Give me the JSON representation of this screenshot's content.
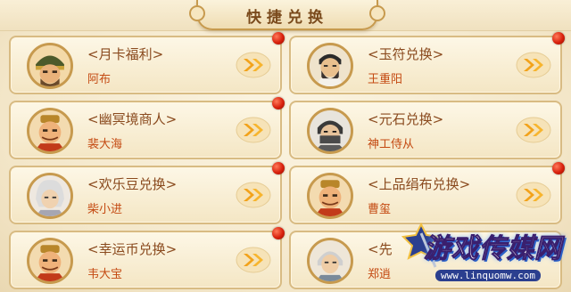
{
  "header": {
    "title": "快捷兑换"
  },
  "cards": [
    {
      "title": "<月卡福利>",
      "npc": "阿布",
      "avatar": "helmet-warrior-avatar-icon",
      "badge": true
    },
    {
      "title": "<玉符兑换>",
      "npc": "王重阳",
      "avatar": "bearded-sage-avatar-icon",
      "badge": true
    },
    {
      "title": "<幽冥境商人>",
      "npc": "裴大海",
      "avatar": "bald-merchant-avatar-icon",
      "badge": true
    },
    {
      "title": "<元石兑换>",
      "npc": "神工侍从",
      "avatar": "masked-attendant-avatar-icon",
      "badge": false
    },
    {
      "title": "<欢乐豆兑换>",
      "npc": "柴小进",
      "avatar": "white-haired-youth-avatar-icon",
      "badge": true
    },
    {
      "title": "<上品绢布兑换>",
      "npc": "曹玺",
      "avatar": "bald-merchant-avatar-icon",
      "badge": true
    },
    {
      "title": "<幸运币兑换>",
      "npc": "韦大宝",
      "avatar": "bald-merchant-avatar-icon",
      "badge": true
    },
    {
      "title": "<先",
      "npc": "郑逍",
      "avatar": "elder-avatar-icon",
      "badge": false
    }
  ],
  "watermark": {
    "title": "游戏传媒网",
    "url": "www.linquomw.com"
  },
  "colors": {
    "title_brown": "#8a4a1e",
    "npc_orange": "#c44a12",
    "frame_gold": "#c79a4e",
    "badge_red": "#d8200c"
  }
}
